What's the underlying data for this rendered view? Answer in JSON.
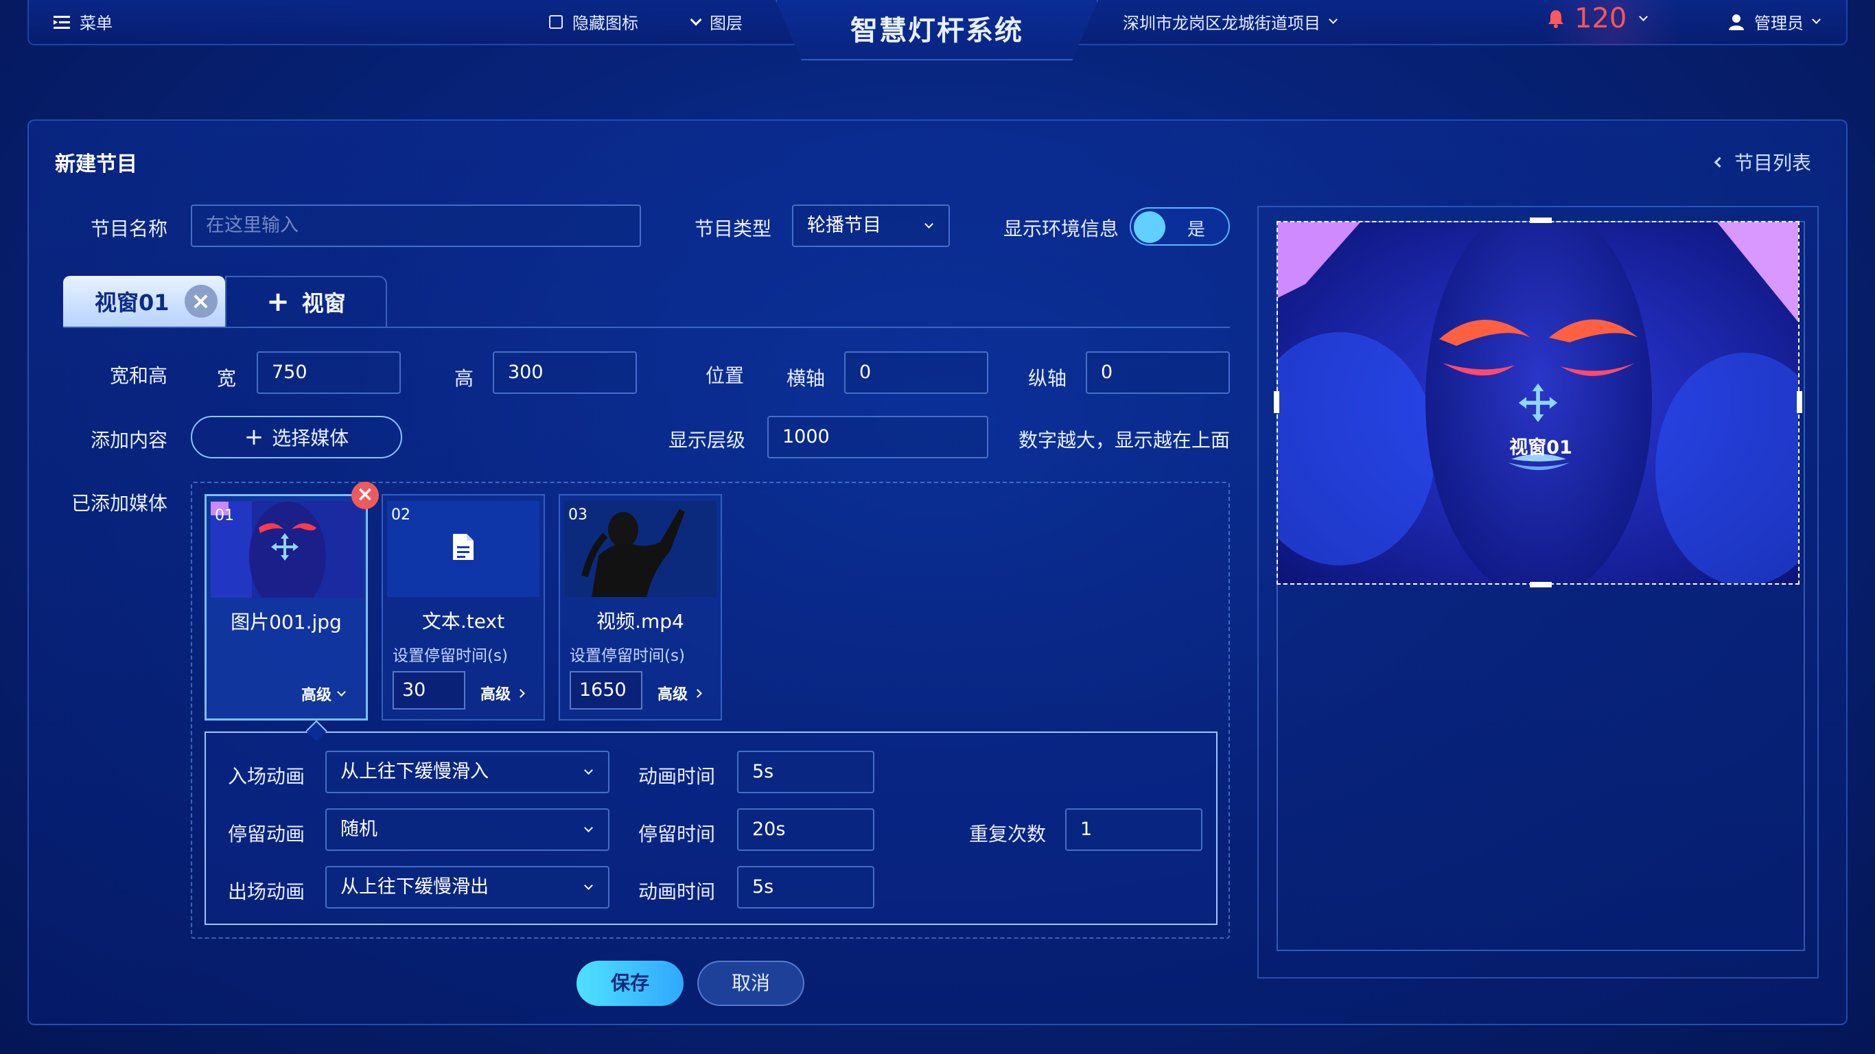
{
  "topbar": {
    "menu_label": "菜单",
    "hide_icons_label": "隐藏图标",
    "layers_label": "图层",
    "title": "智慧灯杆系统",
    "project": "深圳市龙岗区龙城街道项目",
    "alert_count": "120",
    "user": "管理员"
  },
  "panel": {
    "title": "新建节目",
    "back_link": "节目列表"
  },
  "form": {
    "name_label": "节目名称",
    "name_placeholder": "在这里输入",
    "type_label": "节目类型",
    "type_value": "轮播节目",
    "env_label": "显示环境信息",
    "env_toggle": "是",
    "size_label": "宽和高",
    "width_label": "宽",
    "width_value": "750",
    "height_label": "高",
    "height_value": "300",
    "position_label": "位置",
    "x_label": "横轴",
    "x_value": "0",
    "y_label": "纵轴",
    "y_value": "0",
    "add_content_label": "添加内容",
    "select_media_button": "选择媒体",
    "layer_label": "显示层级",
    "layer_value": "1000",
    "layer_hint": "数字越大，显示越在上面",
    "added_media_label": "已添加媒体"
  },
  "tabs": [
    {
      "label": "视窗01",
      "active": true
    },
    {
      "label": "视窗",
      "active": false
    }
  ],
  "media": [
    {
      "num": "01",
      "name": "图片001.jpg",
      "adv": "高级"
    },
    {
      "num": "02",
      "name": "文本.text",
      "stay_label": "设置停留时间(s)",
      "stay_value": "30",
      "adv": "高级"
    },
    {
      "num": "03",
      "name": "视频.mp4",
      "stay_label": "设置停留时间(s)",
      "stay_value": "1650",
      "adv": "高级"
    }
  ],
  "advanced": {
    "enter_label": "入场动画",
    "enter_value": "从上往下缓慢滑入",
    "enter_time_label": "动画时间",
    "enter_time_value": "5s",
    "stay_label": "停留动画",
    "stay_value": "随机",
    "stay_time_label": "停留时间",
    "stay_time_value": "20s",
    "repeat_label": "重复次数",
    "repeat_value": "1",
    "exit_label": "出场动画",
    "exit_value": "从上往下缓慢滑出",
    "exit_time_label": "动画时间",
    "exit_time_value": "5s"
  },
  "buttons": {
    "save": "保存",
    "cancel": "取消"
  },
  "preview": {
    "window_label": "视窗01"
  },
  "colors": {
    "accent": "#4fe0ff",
    "alert": "#ff4d4f",
    "background": "#07237a"
  }
}
